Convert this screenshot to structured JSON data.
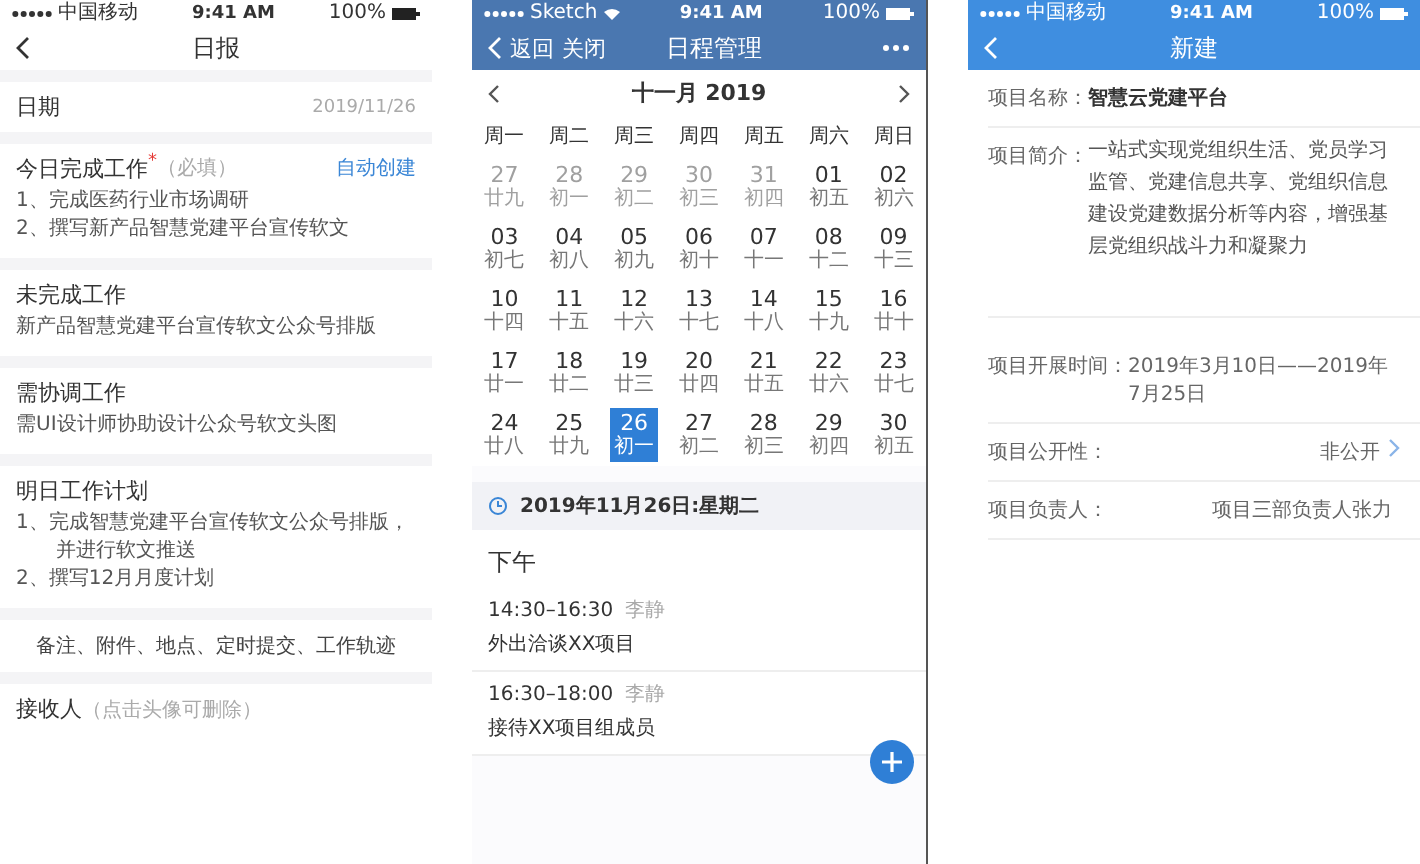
{
  "daily_report": {
    "status_bar": {
      "carrier": "中国移动",
      "time": "9:41 AM",
      "battery": "100%"
    },
    "nav": {
      "title": "日报"
    },
    "date_row": {
      "label": "日期",
      "value": "2019/11/26"
    },
    "sections": [
      {
        "title": "今日完成工作",
        "required_mark": "*",
        "hint": "（必填）",
        "action": "自动创建",
        "lines": [
          "1、完成医药行业市场调研",
          "2、撰写新产品智慧党建平台宣传软文"
        ]
      },
      {
        "title": "未完成工作",
        "lines": [
          "新产品智慧党建平台宣传软文公众号排版"
        ]
      },
      {
        "title": "需协调工作",
        "lines": [
          "需UI设计师协助设计公众号软文头图"
        ]
      },
      {
        "title": "明日工作计划",
        "lines": [
          "1、完成智慧党建平台宣传软文公众号排版，并进行软文推送",
          "2、撰写12月月度计划"
        ]
      }
    ],
    "extras": "备注、附件、地点、定时提交、工作轨迹",
    "receiver": {
      "label": "接收人",
      "hint": "（点击头像可删除）"
    }
  },
  "schedule": {
    "status_bar": {
      "carrier": "Sketch",
      "time": "9:41 AM",
      "battery": "100%"
    },
    "nav": {
      "back": "返回",
      "close": "关闭",
      "title": "日程管理"
    },
    "month_title": "十一月  2019",
    "weekdays": [
      "周一",
      "周二",
      "周三",
      "周四",
      "周五",
      "周六",
      "周日"
    ],
    "weeks": [
      [
        {
          "day": "27",
          "lunar": "廿九",
          "muted": true,
          "selected": false
        },
        {
          "day": "28",
          "lunar": "初一",
          "muted": true,
          "selected": false
        },
        {
          "day": "29",
          "lunar": "初二",
          "muted": true,
          "selected": false
        },
        {
          "day": "30",
          "lunar": "初三",
          "muted": true,
          "selected": false
        },
        {
          "day": "31",
          "lunar": "初四",
          "muted": true,
          "selected": false
        },
        {
          "day": "01",
          "lunar": "初五",
          "muted": false,
          "selected": false
        },
        {
          "day": "02",
          "lunar": "初六",
          "muted": false,
          "selected": false
        }
      ],
      [
        {
          "day": "03",
          "lunar": "初七",
          "muted": false,
          "selected": false
        },
        {
          "day": "04",
          "lunar": "初八",
          "muted": false,
          "selected": false
        },
        {
          "day": "05",
          "lunar": "初九",
          "muted": false,
          "selected": false
        },
        {
          "day": "06",
          "lunar": "初十",
          "muted": false,
          "selected": false
        },
        {
          "day": "07",
          "lunar": "十一",
          "muted": false,
          "selected": false
        },
        {
          "day": "08",
          "lunar": "十二",
          "muted": false,
          "selected": false
        },
        {
          "day": "09",
          "lunar": "十三",
          "muted": false,
          "selected": false
        }
      ],
      [
        {
          "day": "10",
          "lunar": "十四",
          "muted": false,
          "selected": false
        },
        {
          "day": "11",
          "lunar": "十五",
          "muted": false,
          "selected": false
        },
        {
          "day": "12",
          "lunar": "十六",
          "muted": false,
          "selected": false
        },
        {
          "day": "13",
          "lunar": "十七",
          "muted": false,
          "selected": false
        },
        {
          "day": "14",
          "lunar": "十八",
          "muted": false,
          "selected": false
        },
        {
          "day": "15",
          "lunar": "十九",
          "muted": false,
          "selected": false
        },
        {
          "day": "16",
          "lunar": "廿十",
          "muted": false,
          "selected": false
        }
      ],
      [
        {
          "day": "17",
          "lunar": "廿一",
          "muted": false,
          "selected": false
        },
        {
          "day": "18",
          "lunar": "廿二",
          "muted": false,
          "selected": false
        },
        {
          "day": "19",
          "lunar": "廿三",
          "muted": false,
          "selected": false
        },
        {
          "day": "20",
          "lunar": "廿四",
          "muted": false,
          "selected": false
        },
        {
          "day": "21",
          "lunar": "廿五",
          "muted": false,
          "selected": false
        },
        {
          "day": "22",
          "lunar": "廿六",
          "muted": false,
          "selected": false
        },
        {
          "day": "23",
          "lunar": "廿七",
          "muted": false,
          "selected": false
        }
      ],
      [
        {
          "day": "24",
          "lunar": "廿八",
          "muted": false,
          "selected": false
        },
        {
          "day": "25",
          "lunar": "廿九",
          "muted": false,
          "selected": false
        },
        {
          "day": "26",
          "lunar": "初一",
          "muted": false,
          "selected": true
        },
        {
          "day": "27",
          "lunar": "初二",
          "muted": false,
          "selected": false
        },
        {
          "day": "28",
          "lunar": "初三",
          "muted": false,
          "selected": false
        },
        {
          "day": "29",
          "lunar": "初四",
          "muted": false,
          "selected": false
        },
        {
          "day": "30",
          "lunar": "初五",
          "muted": false,
          "selected": false
        }
      ]
    ],
    "date_bar": "2019年11月26日:星期二",
    "period": "下午",
    "events": [
      {
        "time": "14:30–16:30",
        "person": "李静",
        "title": "外出洽谈XX项目"
      },
      {
        "time": "16:30–18:00",
        "person": "李静",
        "title": "接待XX项目组成员"
      }
    ]
  },
  "new_project": {
    "status_bar": {
      "carrier": "中国移动",
      "time": "9:41 AM",
      "battery": "100%"
    },
    "nav": {
      "title": "新建"
    },
    "fields": [
      {
        "kind": "bold",
        "label": "项目名称：",
        "value": "智慧云党建平台"
      },
      {
        "kind": "paragraph",
        "label": "项目简介：",
        "value": "一站式实现党组织生活、党员学习监管、党建信息共享、党组织信息建设党建数据分析等内容，增强基层党组织战斗力和凝聚力"
      },
      {
        "kind": "plain",
        "label": "项目开展时间：",
        "value": "2019年3月10日——2019年7月25日"
      },
      {
        "kind": "select",
        "label": "项目公开性：",
        "value": "非公开"
      },
      {
        "kind": "right",
        "label": "项目负责人：",
        "value": "项目三部负责人张力"
      }
    ]
  }
}
